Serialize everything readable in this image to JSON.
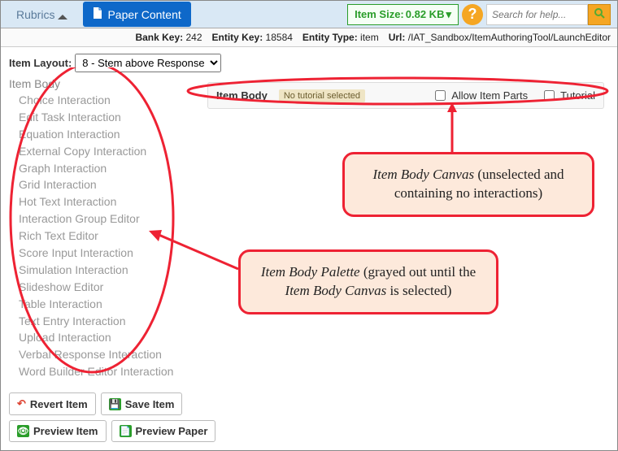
{
  "toolbar": {
    "rubrics_label": "Rubrics",
    "paper_content_label": "Paper Content",
    "item_size_label": "Item Size:",
    "item_size_value": "0.82 KB",
    "search_placeholder": "Search for help..."
  },
  "meta": {
    "bank_key_label": "Bank Key:",
    "bank_key": "242",
    "entity_key_label": "Entity Key:",
    "entity_key": "18584",
    "entity_type_label": "Entity Type:",
    "entity_type": "item",
    "url_label": "Url:",
    "url": "/IAT_Sandbox/ItemAuthoringTool/LaunchEditor"
  },
  "layout": {
    "label": "Item Layout:",
    "selected": "8 - Stem above Response"
  },
  "palette": {
    "head": "Item Body",
    "items": [
      "Choice Interaction",
      "Edit Task Interaction",
      "Equation Interaction",
      "External Copy Interaction",
      "Graph Interaction",
      "Grid Interaction",
      "Hot Text Interaction",
      "Interaction Group Editor",
      "Rich Text Editor",
      "Score Input Interaction",
      "Simulation Interaction",
      "Slideshow Editor",
      "Table Interaction",
      "Text Entry Interaction",
      "Upload Interaction",
      "Verbal Response Interaction",
      "Word Builder Editor Interaction"
    ]
  },
  "canvas": {
    "title": "Item Body",
    "badge": "No tutorial selected",
    "allow_parts_label": "Allow Item Parts",
    "tutorial_label": "Tutorial"
  },
  "buttons": {
    "revert": "Revert Item",
    "save": "Save Item",
    "preview_item": "Preview Item",
    "preview_paper": "Preview Paper"
  },
  "annotations": {
    "canvas_callout_1": "Item Body Canvas",
    "canvas_callout_2": " (unselected and containing no interactions)",
    "palette_callout_1": "Item Body Palette",
    "palette_callout_2": " (grayed out until the ",
    "palette_callout_3": "Item Body Canvas",
    "palette_callout_4": " is selected)"
  }
}
